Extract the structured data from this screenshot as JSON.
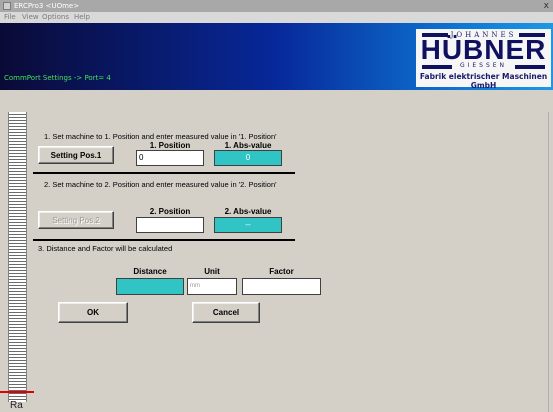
{
  "window": {
    "title": "ERCPro3 <UOme>",
    "close_label": "x"
  },
  "menu": [
    "File",
    "View",
    "Options",
    "Help"
  ],
  "header": {
    "caption": "CommPort Settings -> Port= 4"
  },
  "logo": {
    "top": "JOHANNES",
    "brand": "HÜBNER",
    "city": "GIESSEN",
    "tagline": "Fabrik elektrischer Maschinen GmbH"
  },
  "step1": {
    "instruction": "1. Set machine to 1. Position and enter measured value in '1. Position'",
    "button": "Setting Pos.1",
    "position_label": "1. Position",
    "position_value": "0",
    "abs_label": "1. Abs-value",
    "abs_value": "0"
  },
  "step2": {
    "instruction": "2. Set machine to 2. Position and enter measured value in '2. Position'",
    "button": "Setting Pos.2",
    "position_label": "2. Position",
    "position_value": "",
    "abs_label": "2. Abs-value",
    "abs_value": "--"
  },
  "step3": {
    "instruction": "3. Distance and Factor will be calculated",
    "distance_label": "Distance",
    "distance_value": "",
    "unit_label": "Unit",
    "unit_value": "mm",
    "factor_label": "Factor",
    "factor_value": ""
  },
  "actions": {
    "ok": "OK",
    "cancel": "Cancel"
  },
  "statusbar": {
    "text": "Ra"
  },
  "colors": {
    "teal": "#30c4c4",
    "header_dark": "#07289a",
    "accent_red": "#e00000"
  }
}
